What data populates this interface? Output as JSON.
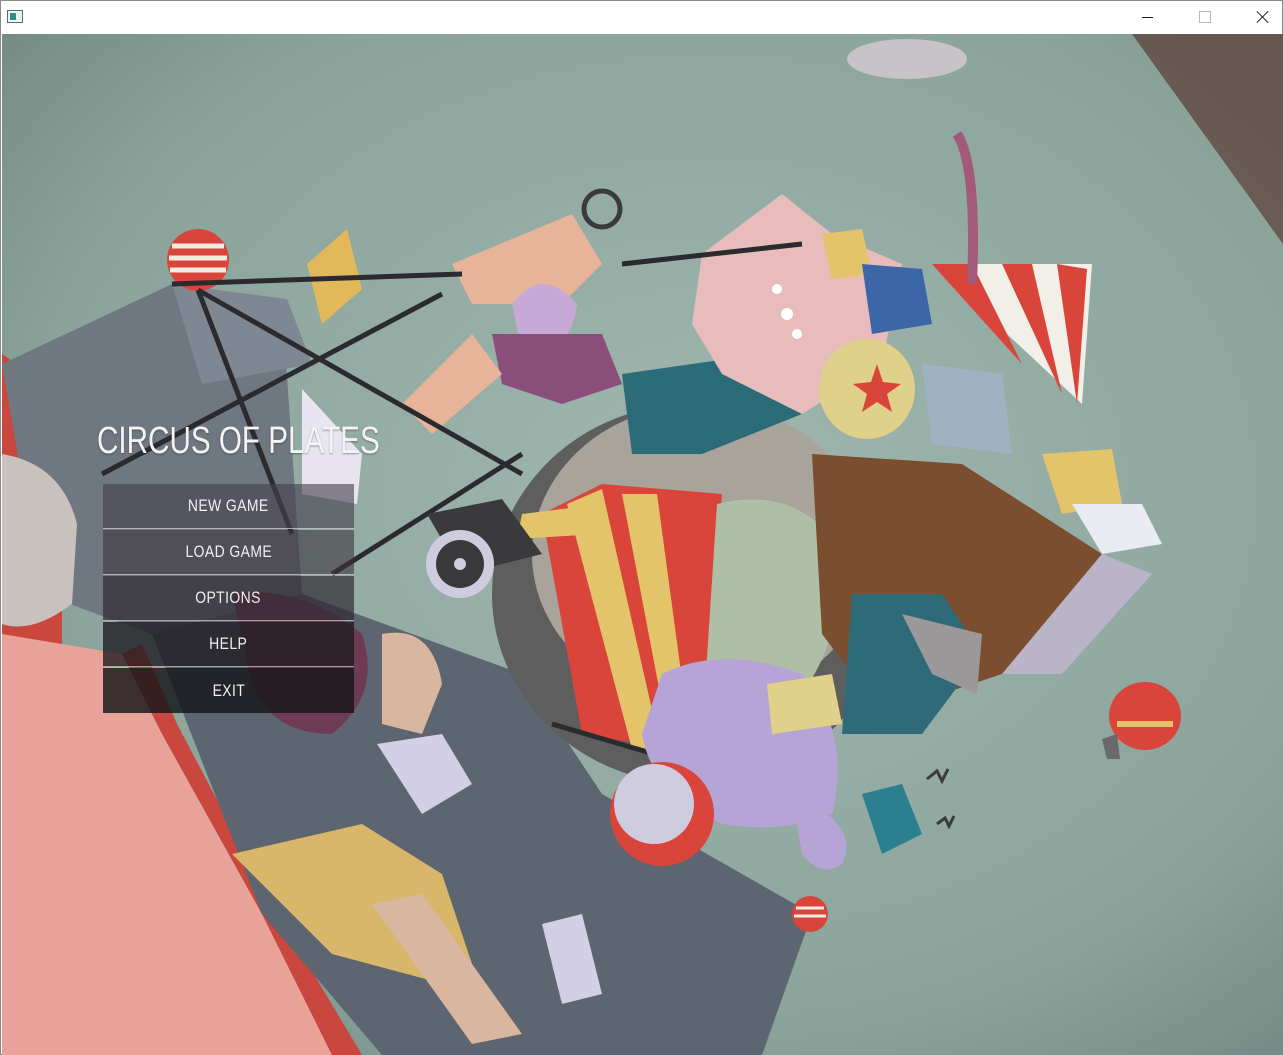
{
  "window": {
    "title": "",
    "icon": "app-window-icon",
    "controls": [
      "minimize-icon",
      "maximize-icon",
      "close-icon"
    ]
  },
  "game": {
    "title": "CIRCUS OF PLATES",
    "menu": [
      {
        "label": "NEW GAME"
      },
      {
        "label": "LOAD GAME"
      },
      {
        "label": "OPTIONS"
      },
      {
        "label": "HELP"
      },
      {
        "label": "EXIT"
      }
    ],
    "background": "paper-cut circus illustration"
  },
  "colors": {
    "background_teal": "#8fa9a1",
    "accent_red": "#d9453a",
    "accent_yellow": "#e3c46a"
  }
}
